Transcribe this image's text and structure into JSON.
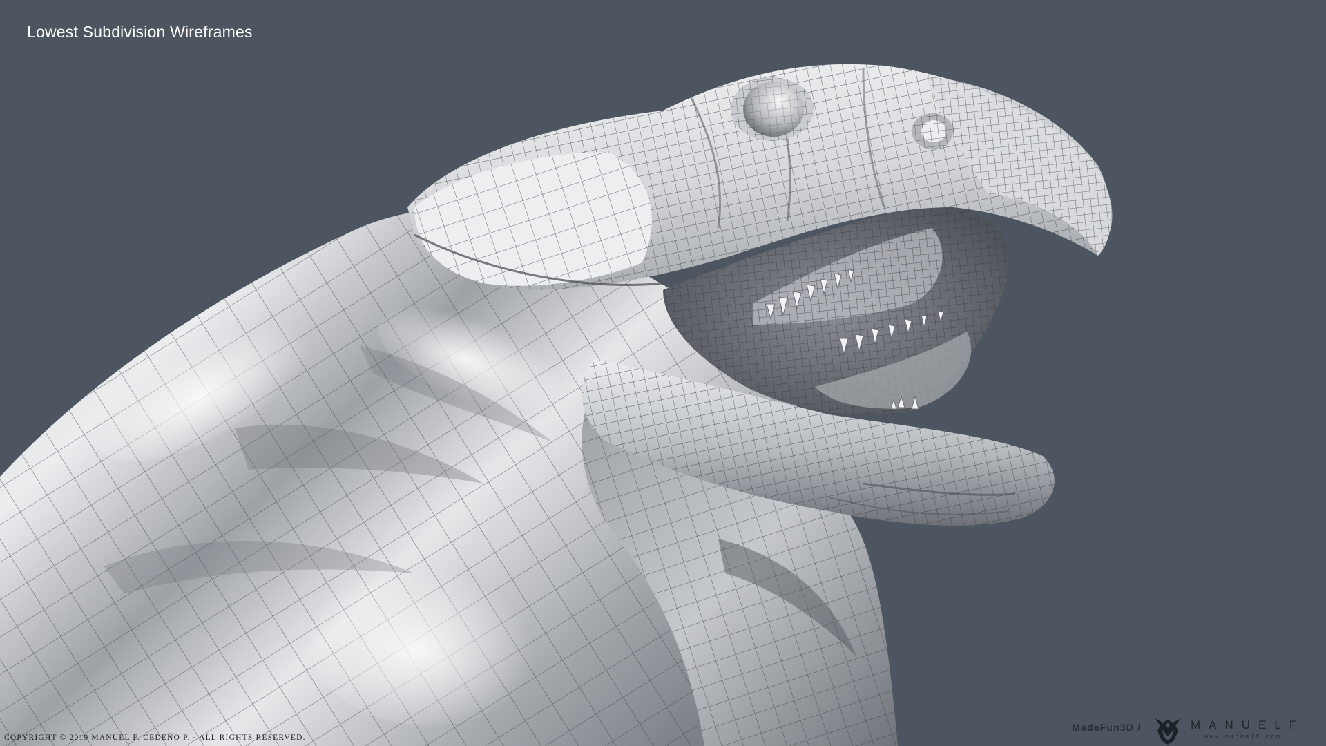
{
  "page": {
    "title": "Lowest Subdivision Wireframes",
    "background_color": "#4d5560"
  },
  "render": {
    "subject": "creature-head-wireframe-model",
    "mesh_color": "#d9dbde",
    "wire_color": "#3b3e44"
  },
  "footer": {
    "copyright": "COPYRIGHT © 2019 MANUEL F. CEDEÑO P.  - ALL RIGHTS RESERVED.",
    "brand_handle": "MadeFun3D /",
    "brand_name": "MANUELF",
    "brand_url": "www.manuelf.com",
    "logo_icon": "manuelf-logo-icon"
  }
}
